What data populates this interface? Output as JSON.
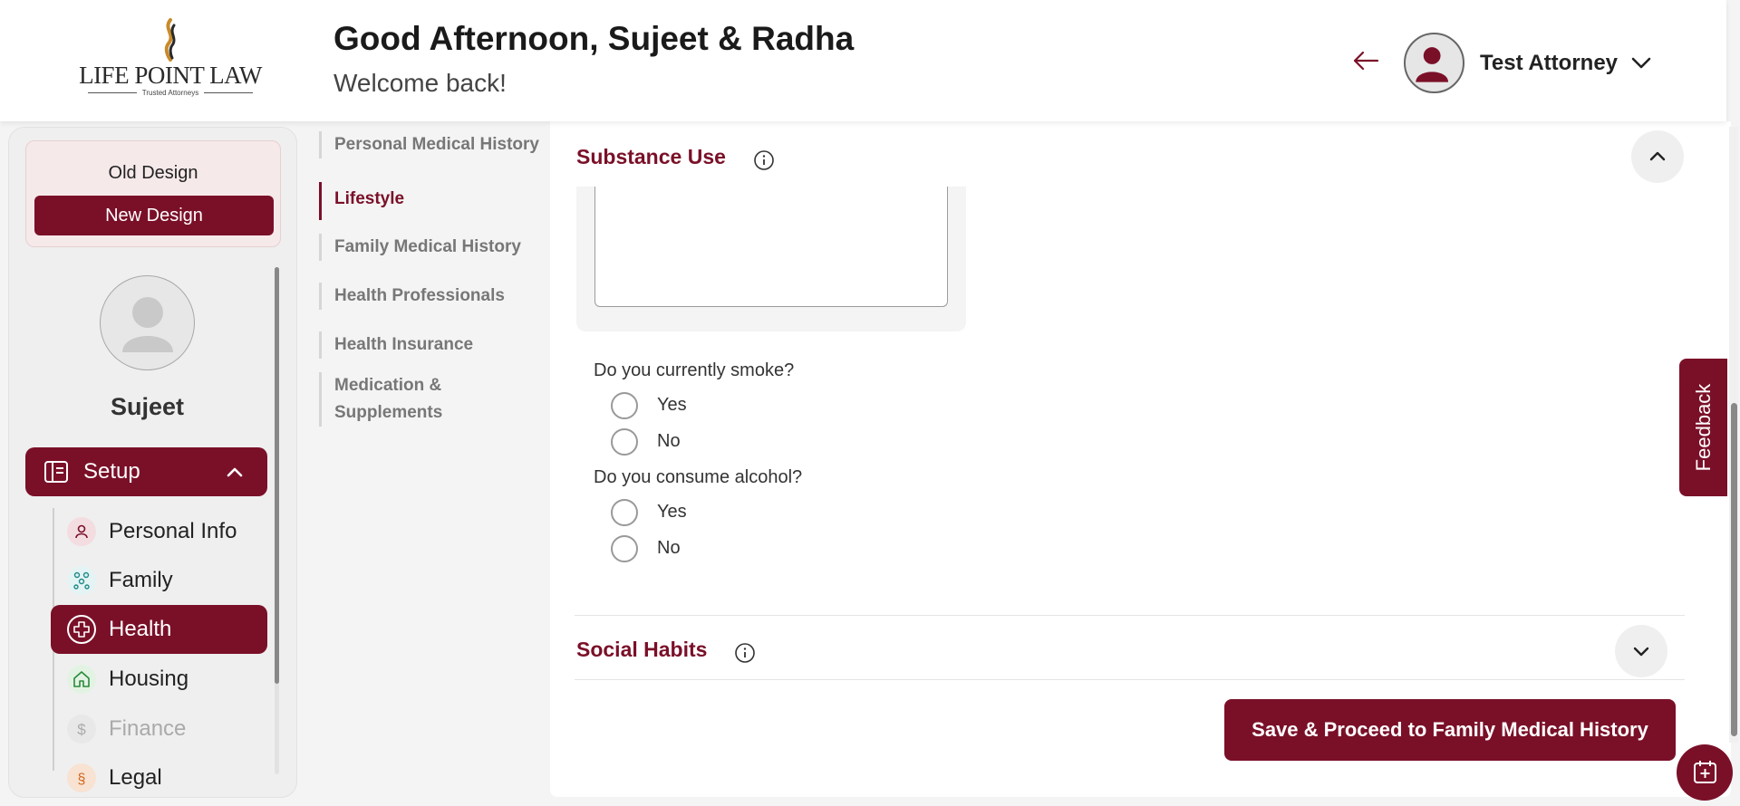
{
  "header": {
    "logo_text": "LIFE POINT LAW",
    "logo_tagline": "Trusted Attorneys",
    "greeting": "Good Afternoon, Sujeet & Radha",
    "subtitle": "Welcome back!",
    "user_name": "Test Attorney"
  },
  "sidebar": {
    "old_design": "Old Design",
    "new_design": "New Design",
    "profile_name": "Sujeet",
    "setup_label": "Setup",
    "items": [
      {
        "label": "Personal Info",
        "icon": "person-icon",
        "state": "normal"
      },
      {
        "label": "Family",
        "icon": "family-tree-icon",
        "state": "normal"
      },
      {
        "label": "Health",
        "icon": "health-cross-icon",
        "state": "active"
      },
      {
        "label": "Housing",
        "icon": "house-icon",
        "state": "normal"
      },
      {
        "label": "Finance",
        "icon": "dollar-icon",
        "state": "disabled"
      },
      {
        "label": "Legal",
        "icon": "legal-icon",
        "state": "normal"
      }
    ]
  },
  "section_nav": {
    "items": [
      {
        "label": "Personal Medical History",
        "active": false
      },
      {
        "label": "Lifestyle",
        "active": true
      },
      {
        "label": "Family Medical History",
        "active": false
      },
      {
        "label": "Health Professionals",
        "active": false
      },
      {
        "label": "Health Insurance",
        "active": false
      },
      {
        "label": "Medication & Supplements",
        "active": false
      }
    ]
  },
  "main": {
    "substance_use": {
      "title": "Substance Use",
      "textarea_value": "",
      "questions": [
        {
          "question": "Do you currently smoke?",
          "options": [
            "Yes",
            "No"
          ],
          "selected": null
        },
        {
          "question": "Do you consume alcohol?",
          "options": [
            "Yes",
            "No"
          ],
          "selected": null
        }
      ]
    },
    "social_habits": {
      "title": "Social Habits"
    },
    "save_button": "Save & Proceed to Family Medical History"
  },
  "feedback_label": "Feedback",
  "colors": {
    "brand": "#7a1028",
    "background": "#f4f4f4",
    "panel": "#ffffff"
  }
}
